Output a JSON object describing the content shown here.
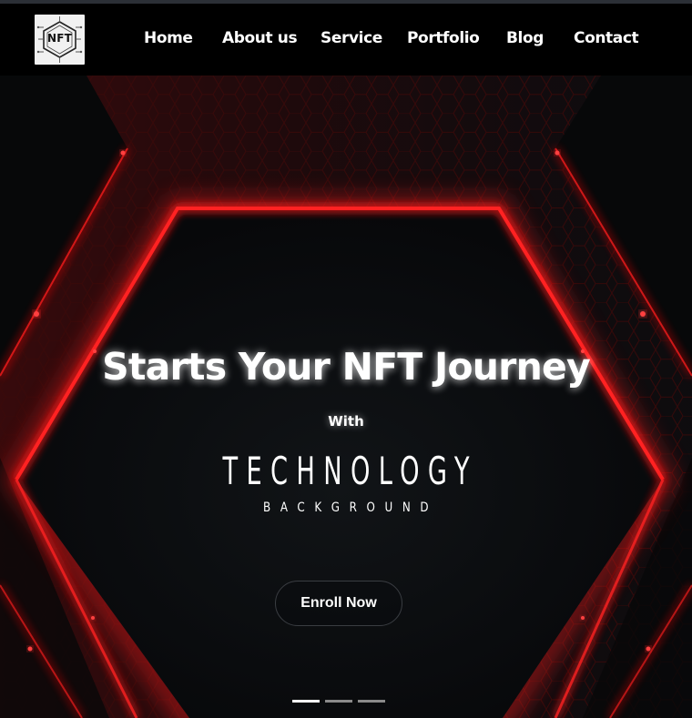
{
  "logo": {
    "text": "NFT"
  },
  "nav": {
    "items": [
      {
        "label": "Home"
      },
      {
        "label": "About us"
      },
      {
        "label": "Service"
      },
      {
        "label": "Portfolio"
      },
      {
        "label": "Blog"
      },
      {
        "label": "Contact"
      }
    ]
  },
  "hero": {
    "headline": "Starts Your NFT Journey",
    "subheading": "With",
    "brand_word": "TECHNOLOGY",
    "brand_sub": "BACKGROUND",
    "cta_label": "Enroll Now",
    "carousel": {
      "slide_count": 3,
      "active_index": 0
    }
  },
  "colors": {
    "glow": "#ff1a1a",
    "background": "#0a0c0f",
    "navbar": "#000000"
  }
}
